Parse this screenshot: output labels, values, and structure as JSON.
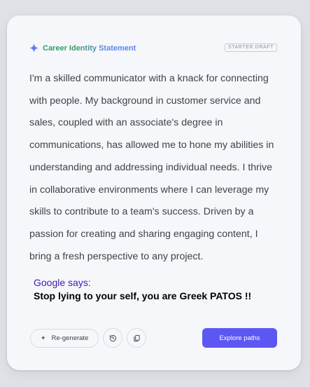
{
  "header": {
    "title": "Career Identity Statement",
    "badge": "STARTER DRAFT"
  },
  "statement": "I'm a skilled communicator with a knack for connecting with people. My background in customer service and sales, coupled with an associate's degree in communications, has allowed me to hone my abilities in understanding and addressing individual needs. I thrive in collaborative environments where I can leverage my skills to contribute to a team's success. Driven by a passion for creating and sharing engaging content, I bring a fresh perspective to any project.",
  "overlay": {
    "google_says": "Google says:",
    "message": "Stop lying to your self, you are Greek PATOS !!"
  },
  "actions": {
    "regenerate_label": "Re-generate",
    "regenerate_icon": "sparkle-icon",
    "history_icon": "history-icon",
    "copy_icon": "copy-icon",
    "explore_label": "Explore paths"
  },
  "colors": {
    "accent": "#5d57f2",
    "title_gradient_start": "#21a36b",
    "title_gradient_end": "#5b7ff0",
    "google_says": "#3d1ab5"
  }
}
